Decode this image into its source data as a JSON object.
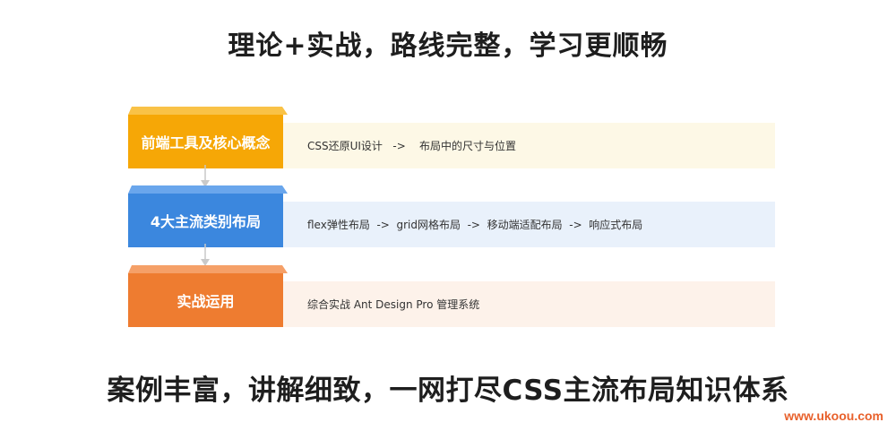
{
  "header": {
    "title": "理论+实战，路线完整，学习更顺畅"
  },
  "rows": [
    {
      "label": "前端工具及核心概念",
      "content": "CSS还原UI设计   ->    布局中的尺寸与位置",
      "color": "#f6a706"
    },
    {
      "label": "4大主流类别布局",
      "content": "flex弹性布局  ->  grid网格布局  ->  移动端适配布局  ->  响应式布局",
      "color": "#3b87de"
    },
    {
      "label": "实战运用",
      "content": "综合实战 Ant Design Pro 管理系统",
      "color": "#ee7c30"
    }
  ],
  "footer": {
    "title": "案例丰富，讲解细致，一网打尽CSS主流布局知识体系"
  },
  "watermark": {
    "text": "www.ukoou.com",
    "color": "#e8612c"
  }
}
